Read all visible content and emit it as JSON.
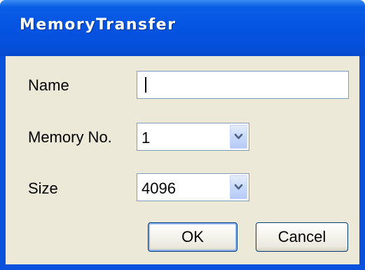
{
  "window": {
    "title": "MemoryTransfer"
  },
  "form": {
    "name_label": "Name",
    "name_value": "",
    "memory_no_label": "Memory No.",
    "memory_no_value": "1",
    "size_label": "Size",
    "size_value": "4096"
  },
  "buttons": {
    "ok_label": "OK",
    "cancel_label": "Cancel"
  },
  "icons": {
    "dropdown": "chevron-down-icon"
  },
  "colors": {
    "titlebar": "#0554e2",
    "client_background": "#ece9d8",
    "input_border": "#7f9db9",
    "button_border": "#003c74"
  }
}
